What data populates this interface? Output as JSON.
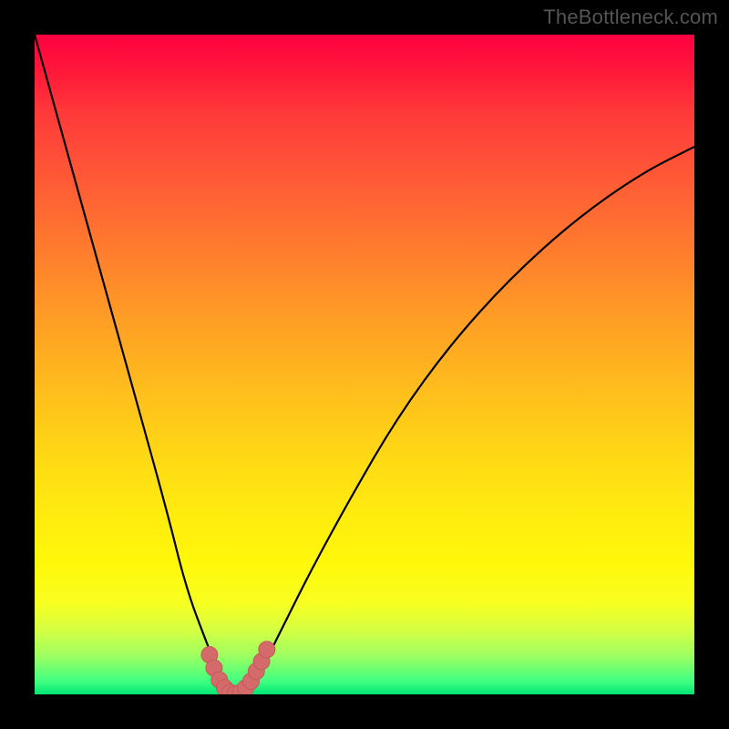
{
  "watermark": "TheBottleneck.com",
  "colors": {
    "frame": "#000000",
    "curve_stroke": "#000000",
    "marker_fill": "#d46a6a",
    "marker_stroke": "#c35a5a"
  },
  "chart_data": {
    "type": "line",
    "title": "",
    "xlabel": "",
    "ylabel": "",
    "xlim": [
      0,
      100
    ],
    "ylim": [
      0,
      100
    ],
    "grid": false,
    "legend": false,
    "series": [
      {
        "name": "bottleneck-curve",
        "x": [
          0,
          5,
          10,
          15,
          20,
          23,
          26,
          28,
          29,
          30,
          31,
          32,
          33,
          35,
          38,
          42,
          48,
          55,
          63,
          72,
          82,
          92,
          100
        ],
        "y": [
          100,
          82,
          64,
          46,
          28,
          16,
          8,
          3,
          1,
          0,
          0,
          1,
          2,
          5,
          11,
          19,
          30,
          42,
          53,
          63,
          72,
          79,
          83
        ]
      }
    ],
    "markers": {
      "name": "valley-markers",
      "points": [
        {
          "x": 26.5,
          "y": 6
        },
        {
          "x": 27.2,
          "y": 4
        },
        {
          "x": 28.0,
          "y": 2.2
        },
        {
          "x": 28.8,
          "y": 1.0
        },
        {
          "x": 29.6,
          "y": 0.3
        },
        {
          "x": 30.4,
          "y": 0.1
        },
        {
          "x": 31.2,
          "y": 0.3
        },
        {
          "x": 32.0,
          "y": 1.0
        },
        {
          "x": 32.8,
          "y": 2.0
        },
        {
          "x": 33.6,
          "y": 3.5
        },
        {
          "x": 34.4,
          "y": 5.0
        },
        {
          "x": 35.2,
          "y": 6.8
        }
      ]
    }
  }
}
